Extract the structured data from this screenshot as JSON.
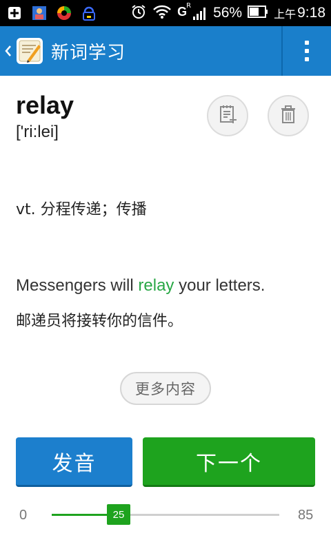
{
  "status_bar": {
    "battery": "56%",
    "ampm": "上午",
    "time": "9:18",
    "network": "G",
    "network_sup": "R"
  },
  "app_bar": {
    "title": "新词学习"
  },
  "word": {
    "text": "relay",
    "phonetic": "['ri:lei]"
  },
  "definition": "vt. 分程传递；传播",
  "example": {
    "before": "Messengers will ",
    "highlight": "relay",
    "after": " your letters.",
    "translation": "邮递员将接转你的信件。"
  },
  "more_button": "更多内容",
  "pronounce_button": "发音",
  "next_button": "下一个",
  "progress": {
    "min": "0",
    "max": "85",
    "value": "25"
  },
  "colors": {
    "app_bar": "#1a7fcb",
    "highlight": "#28a745",
    "pronounce": "#1c7fcd",
    "next": "#1ea31e"
  }
}
